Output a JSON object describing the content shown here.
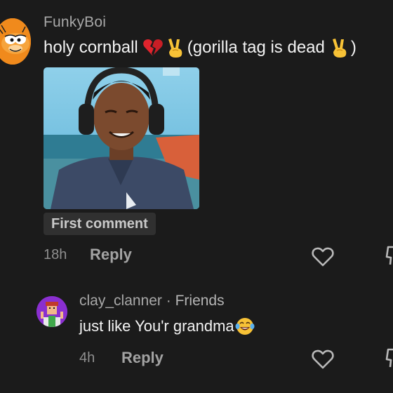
{
  "comments": [
    {
      "username": "FunkyBoi",
      "text_part1": "holy cornball",
      "text_part2": "(gorilla tag is dead",
      "text_part3": ")",
      "badge": "First comment",
      "time": "18h",
      "reply_label": "Reply",
      "avatar": "garfield-avatar"
    },
    {
      "username": "clay_clanner",
      "separator": " · ",
      "relation": "Friends",
      "text": "just like You'r grandma",
      "time": "4h",
      "reply_label": "Reply",
      "avatar": "character-avatar"
    }
  ],
  "icons": {
    "emoji_1": "broken-heart-emoji",
    "emoji_2": "victory-hand-emoji",
    "emoji_3": "tears-of-joy-emoji",
    "like": "heart-outline-icon",
    "dislike": "thumbs-down-icon"
  },
  "colors": {
    "background": "#1b1b1b",
    "text_primary": "#f3f3f3",
    "text_secondary": "#a8a8a8",
    "badge_bg": "#303030"
  }
}
